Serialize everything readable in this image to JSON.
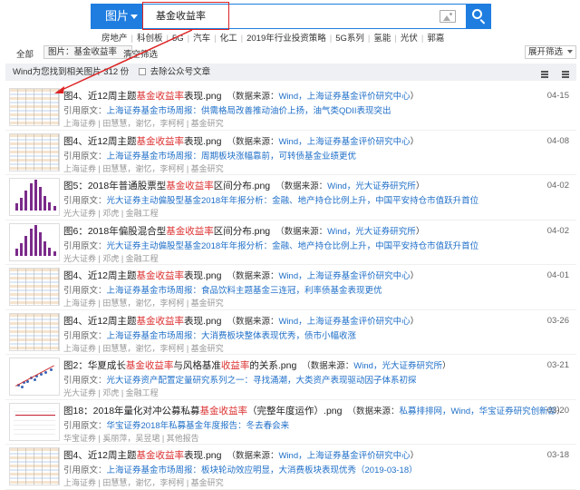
{
  "search": {
    "type_label": "图片",
    "query": "基金收益率"
  },
  "tags": [
    "房地产",
    "科创板",
    "5G",
    "汽车",
    "化工",
    "2019年行业投资策略",
    "5G系列",
    "氢能",
    "光伏",
    "郭嘉"
  ],
  "filters": {
    "all": "全部",
    "chip": "图片：基金收益率",
    "clear": "清空筛选",
    "expand": "展开筛选"
  },
  "summary": {
    "found": "Wind为您找到相关图片 312 份",
    "dedupe": "去除公众号文章"
  },
  "results": [
    {
      "thumb": "table",
      "title_pre": "图4、近12周主题",
      "title_hl": "基金收益率",
      "title_post": "表现.png",
      "src_pre": "（数据来源：",
      "src_link": "Wind，上海证券基金评价研究中心",
      "src_post": "）",
      "ref_label": "引用原文：",
      "ref_text": "上海证券基金市场周报：供需格局改善推动油价上扬，油气类QDII表现突出",
      "meta": "上海证券 | 田慧慧，谢忆，李柯柯 | 基金研究",
      "date": "04-15"
    },
    {
      "thumb": "table",
      "title_pre": "图4、近12周主题",
      "title_hl": "基金收益率",
      "title_post": "表现.png",
      "src_pre": "（数据来源：",
      "src_link": "Wind，上海证券基金评价研究中心",
      "src_post": "）",
      "ref_label": "引用原文：",
      "ref_text": "上海证券基金市场周报：周期板块涨幅靠前，可转债基金业绩更优",
      "meta": "上海证券 | 田慧慧，谢忆，李柯柯 | 基金研究",
      "date": "04-08"
    },
    {
      "thumb": "bars",
      "title_pre": "图5：2018年普通股票型",
      "title_hl": "基金收益率",
      "title_post": "区间分布.png",
      "src_pre": "（数据来源：",
      "src_link": "Wind，光大证券研究所",
      "src_post": "）",
      "ref_label": "引用原文：",
      "ref_text": "光大证券主动偏股型基金2018年年报分析：金融、地产持仓比例上升，中国平安持仓市值跃升首位",
      "meta": "光大证券 | 邓虎 | 金融工程",
      "date": "04-02"
    },
    {
      "thumb": "bars",
      "title_pre": "图6：2018年偏股混合型",
      "title_hl": "基金收益率",
      "title_post": "区间分布.png",
      "src_pre": "（数据来源：",
      "src_link": "Wind，光大证券研究所",
      "src_post": "）",
      "ref_label": "引用原文：",
      "ref_text": "光大证券主动偏股型基金2018年年报分析：金融、地产持仓比例上升，中国平安持仓市值跃升首位",
      "meta": "光大证券 | 邓虎 | 金融工程",
      "date": "04-02"
    },
    {
      "thumb": "table",
      "title_pre": "图4、近12周主题",
      "title_hl": "基金收益率",
      "title_post": "表现.png",
      "src_pre": "（数据来源：",
      "src_link": "Wind，上海证券基金评价研究中心",
      "src_post": "）",
      "ref_label": "引用原文：",
      "ref_text": "上海证券基金市场周报：食品饮料主题基金三连冠，利率债基金表现更优",
      "meta": "上海证券 | 田慧慧，谢忆，李柯柯 | 基金研究",
      "date": "04-01"
    },
    {
      "thumb": "table",
      "title_pre": "图4、近12周主题",
      "title_hl": "基金收益率",
      "title_post": "表现.png",
      "src_pre": "（数据来源：",
      "src_link": "Wind，上海证券基金评价研究中心",
      "src_post": "）",
      "ref_label": "引用原文：",
      "ref_text": "上海证券基金市场周报：大消费板块整体表现优秀，债市小幅收涨",
      "meta": "上海证券 | 田慧慧，谢忆，李柯柯 | 基金研究",
      "date": "03-26"
    },
    {
      "thumb": "scatter",
      "title_pre": "图2：华夏成长",
      "title_hl": "基金收益率",
      "title_mid": "与风格基准",
      "title_hl2": "收益率",
      "title_post": "的关系.png",
      "src_pre": "（数据来源：",
      "src_link": "Wind，光大证券研究所",
      "src_post": "）",
      "ref_label": "引用原文：",
      "ref_text": "光大证券资产配置定量研究系列之一：寻找涌潮，大类资产表现驱动因子体系初探",
      "meta": "光大证券 | 邓虎 | 金融工程",
      "date": "03-21"
    },
    {
      "thumb": "perf",
      "title_pre": "图18：2018年量化对冲公募私募",
      "title_hl": "基金收益率",
      "title_post": "（完整年度运作）.png",
      "src_pre": "（数据来源：",
      "src_link": "私募排排网，Wind，华宝证券研究创新部",
      "src_post": "）",
      "ref_label": "引用原文：",
      "ref_text": "华宝证券2018年私募基金年度报告：冬去春会来",
      "meta": "华宝证券 | 奚丽萍，吴昱珺 | 其他报告",
      "date": "03-20"
    },
    {
      "thumb": "table",
      "title_pre": "图4、近12周主题",
      "title_hl": "基金收益率",
      "title_post": "表现.png",
      "src_pre": "（数据来源：",
      "src_link": "Wind，上海证券基金评价研究中心",
      "src_post": "）",
      "ref_label": "引用原文：",
      "ref_text": "上海证券基金市场周报：板块轮动效应明显，大消费板块表现优秀（2019-03-18）",
      "meta": "上海证券 | 田慧慧，谢忆，李柯柯 | 基金研究",
      "date": "03-18"
    }
  ]
}
